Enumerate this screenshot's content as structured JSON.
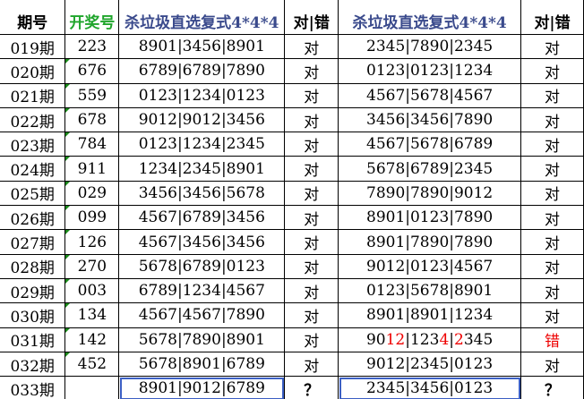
{
  "headers": {
    "period": "期号",
    "draw": "开奖号",
    "kill1": "杀垃圾直选复式4*4*4",
    "result1": "对|错",
    "kill2": "杀垃圾直选复式4*4*4",
    "result2": "对|错"
  },
  "rows": [
    {
      "period": "019期",
      "draw": "223",
      "kill1": "8901|3456|8901",
      "r1": "对",
      "kill2": [
        {
          "t": "2345|7890|2345"
        }
      ],
      "r2": "对"
    },
    {
      "period": "020期",
      "draw": "676",
      "kill1": "6789|6789|7890",
      "r1": "对",
      "kill2": [
        {
          "t": "0123|0123|1234"
        }
      ],
      "r2": "对"
    },
    {
      "period": "021期",
      "draw": "559",
      "kill1": "0123|1234|0123",
      "r1": "对",
      "kill2": [
        {
          "t": "4567|5678|4567"
        }
      ],
      "r2": "对"
    },
    {
      "period": "022期",
      "draw": "678",
      "kill1": "9012|9012|3456",
      "r1": "对",
      "kill2": [
        {
          "t": "3456|3456|7890"
        }
      ],
      "r2": "对"
    },
    {
      "period": "023期",
      "draw": "784",
      "kill1": "0123|1234|2345",
      "r1": "对",
      "kill2": [
        {
          "t": "4567|5678|6789"
        }
      ],
      "r2": "对"
    },
    {
      "period": "024期",
      "draw": "911",
      "kill1": "1234|2345|8901",
      "r1": "对",
      "kill2": [
        {
          "t": "5678|6789|2345"
        }
      ],
      "r2": "对"
    },
    {
      "period": "025期",
      "draw": "029",
      "kill1": "3456|3456|5678",
      "r1": "对",
      "kill2": [
        {
          "t": "7890|7890|9012"
        }
      ],
      "r2": "对"
    },
    {
      "period": "026期",
      "draw": "099",
      "kill1": "4567|6789|3456",
      "r1": "对",
      "kill2": [
        {
          "t": "8901|0123|7890"
        }
      ],
      "r2": "对"
    },
    {
      "period": "027期",
      "draw": "126",
      "kill1": "4567|3456|3456",
      "r1": "对",
      "kill2": [
        {
          "t": "8901|7890|7890"
        }
      ],
      "r2": "对"
    },
    {
      "period": "028期",
      "draw": "270",
      "kill1": "5678|6789|0123",
      "r1": "对",
      "kill2": [
        {
          "t": "9012|0123|4567"
        }
      ],
      "r2": "对"
    },
    {
      "period": "029期",
      "draw": "003",
      "kill1": "6789|1234|4567",
      "r1": "对",
      "kill2": [
        {
          "t": "0123|5678|8901"
        }
      ],
      "r2": "对"
    },
    {
      "period": "030期",
      "draw": "134",
      "kill1": "4567|4567|7890",
      "r1": "对",
      "kill2": [
        {
          "t": "8901|8901|1234"
        }
      ],
      "r2": "对"
    },
    {
      "period": "031期",
      "draw": "142",
      "kill1": "5678|7890|8901",
      "r1": "对",
      "kill2": [
        {
          "t": "90"
        },
        {
          "t": "12",
          "red": true
        },
        {
          "t": "|123"
        },
        {
          "t": "4",
          "red": true
        },
        {
          "t": "|"
        },
        {
          "t": "2",
          "red": true
        },
        {
          "t": "345"
        }
      ],
      "r2": "错",
      "r2red": true
    },
    {
      "period": "032期",
      "draw": "452",
      "kill1": "5678|8901|6789",
      "r1": "对",
      "kill2": [
        {
          "t": "9012|2345|0123"
        }
      ],
      "r2": "对"
    },
    {
      "period": "033期",
      "draw": "",
      "kill1": "8901|9012|6789",
      "r1": "？",
      "kill2": [
        {
          "t": "2345|3456|0123"
        }
      ],
      "r2": "？",
      "pending": true
    }
  ],
  "colors": {
    "green": "#1fa52b",
    "blue": "#3a4a8c",
    "red": "#e00000",
    "box": "#3b5fc4"
  }
}
